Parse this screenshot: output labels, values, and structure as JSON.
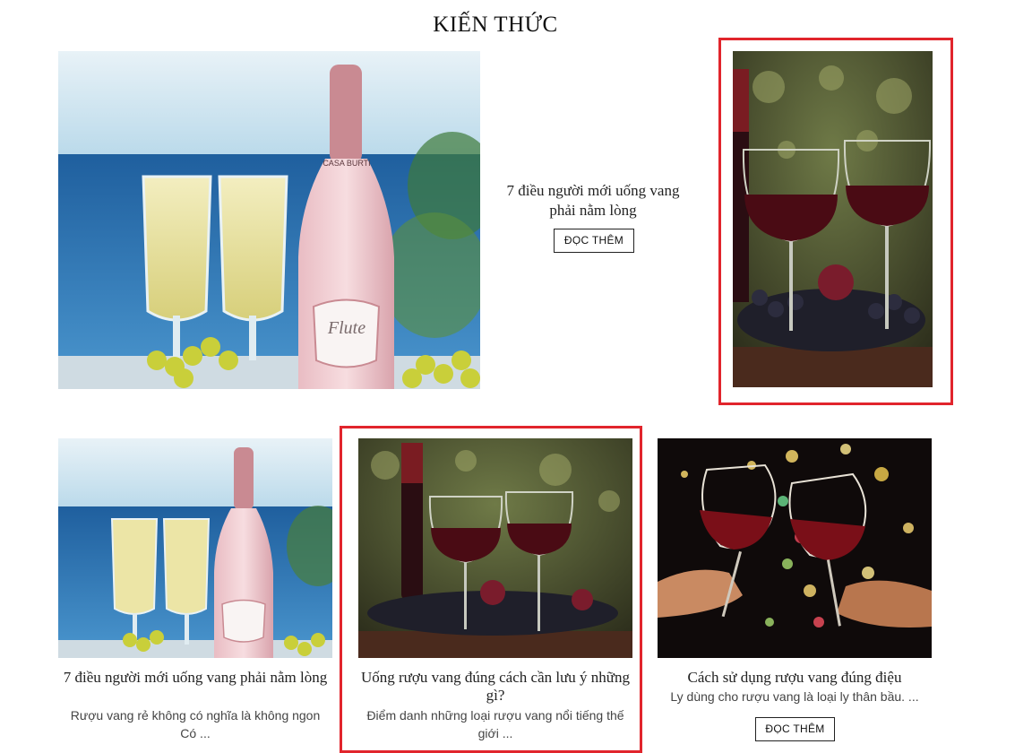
{
  "section": {
    "title": "KIẾN THỨC"
  },
  "featured": {
    "title": "7 điều người mới uống vang phải nằm lòng",
    "button": "ĐỌC THÊM"
  },
  "cards": [
    {
      "title": "7 điều người mới uống vang phải nằm lòng",
      "desc": "Rượu vang rẻ không có nghĩa là không ngon Có ..."
    },
    {
      "title": "Uống rượu vang đúng cách cần lưu ý những gì?",
      "desc": "Điểm danh những loại rượu vang nổi tiếng thế giới ..."
    },
    {
      "title": "Cách sử dụng rượu vang đúng điệu",
      "desc": "Ly dùng cho rượu vang là loại ly thân bầu. ...",
      "button": "ĐỌC THÊM"
    }
  ],
  "bottle_label": {
    "brand": "CASA BURTI",
    "name": "Flute"
  },
  "colors": {
    "highlight": "#e1252c",
    "wine": "#5a0f14",
    "sea": "#2f76b5",
    "sky": "#cfe6f3"
  }
}
